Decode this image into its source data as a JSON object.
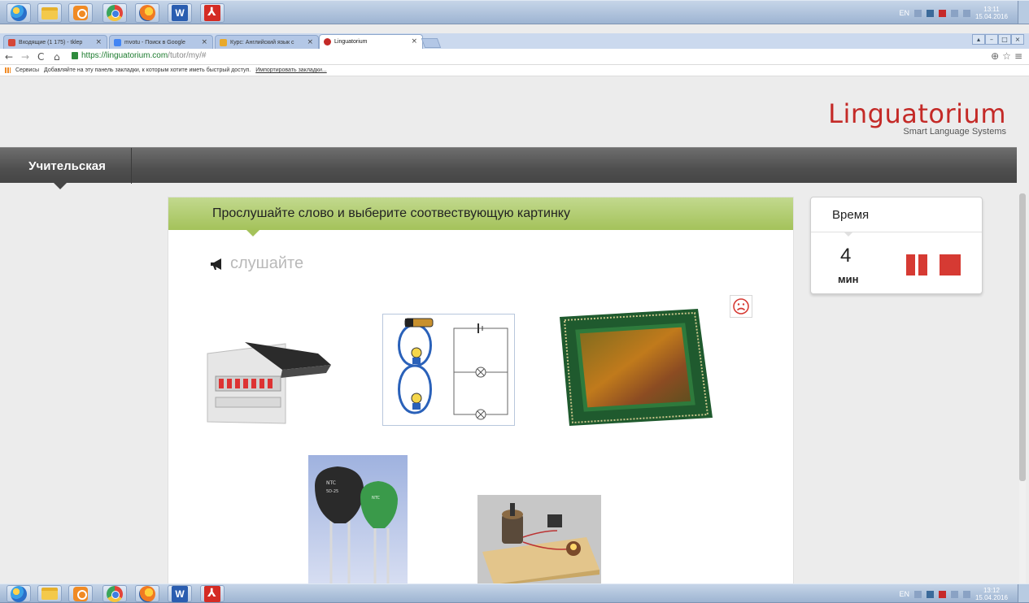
{
  "taskbar": {
    "top_apps": [
      "start-orb",
      "file-explorer",
      "media-player",
      "chrome",
      "firefox",
      "word",
      "acrobat"
    ],
    "top_clock_time": "13:11",
    "top_clock_date": "15.04.2016",
    "bottom_clock_time": "13:12",
    "bottom_clock_date": "15.04.2016",
    "lang": "EN"
  },
  "browser": {
    "tabs": [
      {
        "title": "Входящие (1 175) - tklep",
        "favicon_color": "#d44638"
      },
      {
        "title": "mvotu - Поиск в Google",
        "favicon_color": "#4285f4"
      },
      {
        "title": "Курс: Английский язык с",
        "favicon_color": "#e8a92c"
      },
      {
        "title": "Linguatorium",
        "favicon_color": "#c42a27",
        "active": true
      }
    ],
    "url_scheme_host": "https://linguatorium.com",
    "url_path": "/tutor/my/#",
    "bookmarks_apps": "Сервисы",
    "bookmarks_hint": "Добавляйте на эту панель закладки, к которым хотите иметь быстрый доступ.",
    "bookmarks_import": "Импортировать закладки..."
  },
  "site": {
    "logo_name": "Linguatorium",
    "logo_tagline": "Smart Language Systems",
    "nav_item": "Учительская"
  },
  "exercise": {
    "instruction": "Прослушайте слово и выберите соотвествующую картинку",
    "listen_label": "слушайте",
    "images": [
      "distribution-board-image",
      "circuit-diagram-image",
      "image-sensor-chip-image",
      "ntc-thermistor-image",
      "motor-circuit-model-image"
    ],
    "thermistor_labels": [
      "NTC",
      "5D-25",
      "NTC"
    ]
  },
  "timer": {
    "title": "Время",
    "value": "4",
    "unit": "мин"
  },
  "colors": {
    "brand_red": "#c42a27",
    "header_green": "#a4c25a",
    "control_red": "#d63a33"
  }
}
